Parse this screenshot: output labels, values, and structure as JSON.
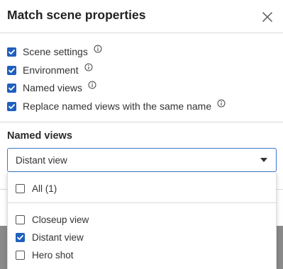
{
  "dialog": {
    "title": "Match scene properties",
    "close_icon": "close-icon"
  },
  "options": [
    {
      "label": "Scene settings",
      "checked": true,
      "info": true
    },
    {
      "label": "Environment",
      "checked": true,
      "info": true
    },
    {
      "label": "Named views",
      "checked": true,
      "info": true
    },
    {
      "label": "Replace named views with the same name",
      "checked": true,
      "info": true
    }
  ],
  "named_views": {
    "section_label": "Named views",
    "selected_value": "Distant view",
    "dropdown": {
      "all_item": {
        "label": "All (1)",
        "checked": false
      },
      "items": [
        {
          "label": "Closeup view",
          "checked": false
        },
        {
          "label": "Distant view",
          "checked": true
        },
        {
          "label": "Hero shot",
          "checked": false
        }
      ]
    }
  },
  "colors": {
    "accent": "#1f5fbf",
    "focus_border": "#3a78c9",
    "backdrop": "#8a8a8a"
  }
}
